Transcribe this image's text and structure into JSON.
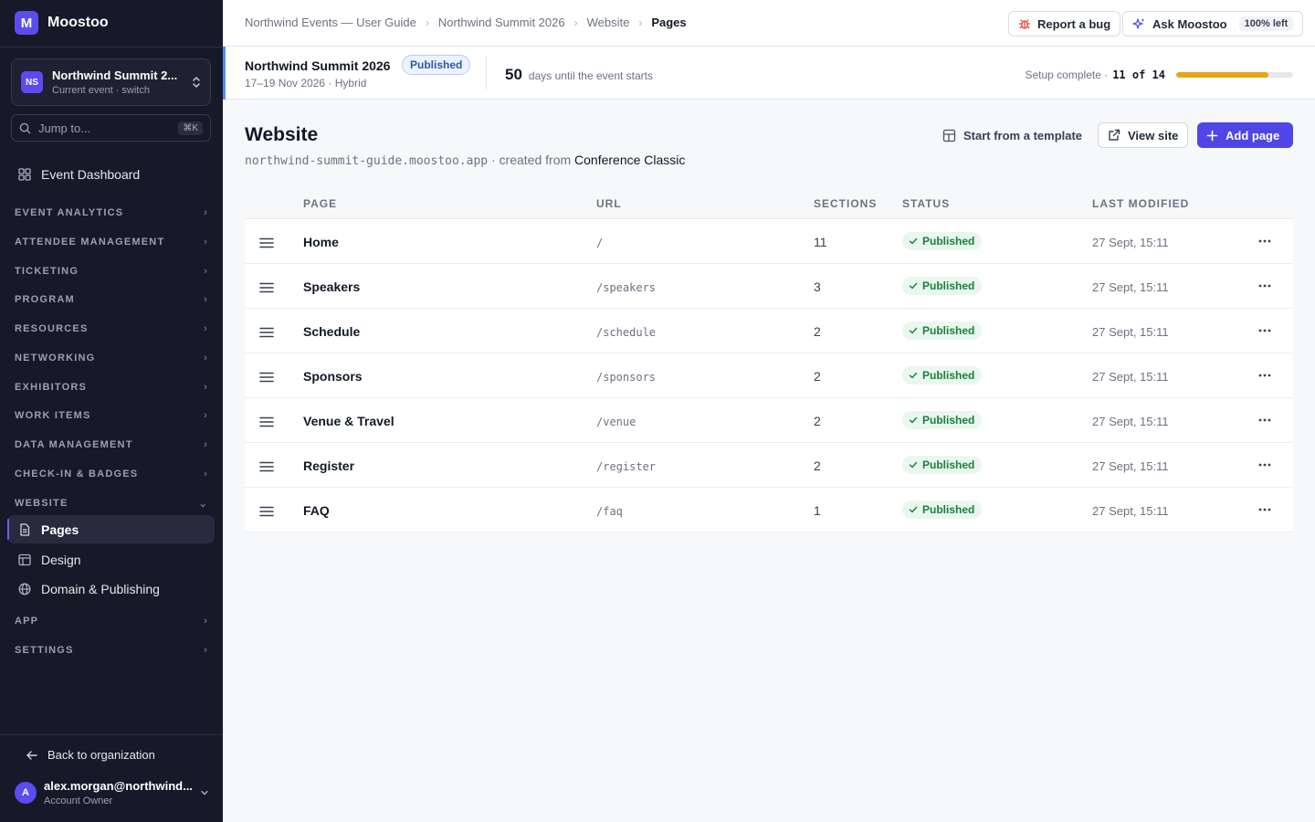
{
  "brand": {
    "logo": "M",
    "name": "Moostoo"
  },
  "event_switcher": {
    "badge": "NS",
    "name": "Northwind Summit 2...",
    "sub": "Current event · switch"
  },
  "jump": {
    "placeholder": "Jump to...",
    "shortcut": "⌘K"
  },
  "nav": {
    "dashboard": "Event Dashboard",
    "sections": {
      "analytics": "EVENT ANALYTICS",
      "attendee": "ATTENDEE MANAGEMENT",
      "ticketing": "TICKETING",
      "program": "PROGRAM",
      "resources": "RESOURCES",
      "networking": "NETWORKING",
      "exhibitors": "EXHIBITORS",
      "work_items": "WORK ITEMS",
      "data": "DATA MANAGEMENT",
      "checkin": "CHECK-IN & BADGES",
      "website": "WEBSITE",
      "app": "APP",
      "settings": "SETTINGS"
    },
    "website_items": {
      "pages": "Pages",
      "design": "Design",
      "domain": "Domain & Publishing"
    }
  },
  "back_org": "Back to organization",
  "user": {
    "initial": "A",
    "email": "alex.morgan@northwind...",
    "role": "Account Owner"
  },
  "breadcrumbs": [
    "Northwind Events — User Guide",
    "Northwind Summit 2026",
    "Website",
    "Pages"
  ],
  "top_actions": {
    "report": "Report a bug",
    "ask": "Ask Moostoo",
    "ask_badge": "100% left"
  },
  "event": {
    "name": "Northwind Summit 2026",
    "status": "Published",
    "meta": "17–19 Nov 2026 · Hybrid",
    "days_num": "50",
    "days_label": "days until the event starts",
    "setup_label": "Setup complete ·",
    "setup_count": "11 of 14",
    "setup_done": 11,
    "setup_total": 14
  },
  "page": {
    "title": "Website",
    "domain": "northwind-summit-guide.moostoo.app",
    "created_text": "· created from",
    "template": "Conference Classic"
  },
  "actions": {
    "template": "Start from a template",
    "view": "View site",
    "add": "Add page"
  },
  "table": {
    "headers": {
      "page": "PAGE",
      "url": "URL",
      "sections": "SECTIONS",
      "status": "STATUS",
      "modified": "LAST MODIFIED"
    },
    "rows": [
      {
        "page": "Home",
        "url": "/",
        "sections": "11",
        "status": "Published",
        "modified": "27 Sept, 15:11"
      },
      {
        "page": "Speakers",
        "url": "/speakers",
        "sections": "3",
        "status": "Published",
        "modified": "27 Sept, 15:11"
      },
      {
        "page": "Schedule",
        "url": "/schedule",
        "sections": "2",
        "status": "Published",
        "modified": "27 Sept, 15:11"
      },
      {
        "page": "Sponsors",
        "url": "/sponsors",
        "sections": "2",
        "status": "Published",
        "modified": "27 Sept, 15:11"
      },
      {
        "page": "Venue & Travel",
        "url": "/venue",
        "sections": "2",
        "status": "Published",
        "modified": "27 Sept, 15:11"
      },
      {
        "page": "Register",
        "url": "/register",
        "sections": "2",
        "status": "Published",
        "modified": "27 Sept, 15:11"
      },
      {
        "page": "FAQ",
        "url": "/faq",
        "sections": "1",
        "status": "Published",
        "modified": "27 Sept, 15:11"
      }
    ]
  },
  "colors": {
    "accent": "#4f46e5",
    "brand": "#5b4cf0",
    "success": "#17803d",
    "progress": "#e8a317",
    "sidebar": "#161927"
  }
}
